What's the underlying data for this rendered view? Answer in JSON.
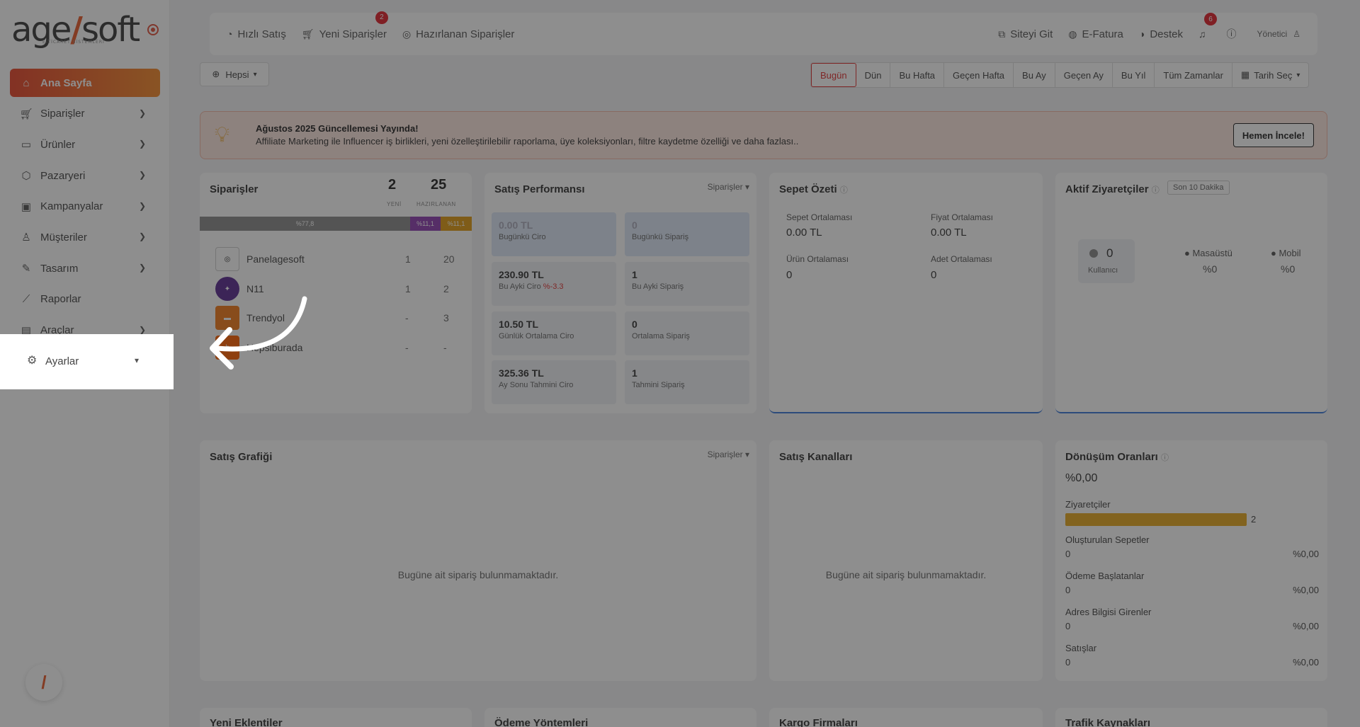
{
  "logo": {
    "brand_a": "age",
    "brand_b": "soft",
    "tagline": "E-TİCARET SİSTEMLERİ"
  },
  "sidebar": {
    "items": [
      {
        "label": "Ana Sayfa",
        "icon": "home-icon",
        "active": true
      },
      {
        "label": "Siparişler",
        "icon": "cart-icon"
      },
      {
        "label": "Ürünler",
        "icon": "book-icon"
      },
      {
        "label": "Pazaryeri",
        "icon": "box-icon"
      },
      {
        "label": "Kampanyalar",
        "icon": "gift-icon"
      },
      {
        "label": "Müşteriler",
        "icon": "user-icon"
      },
      {
        "label": "Tasarım",
        "icon": "edit-icon"
      },
      {
        "label": "Raporlar",
        "icon": "chart-icon"
      },
      {
        "label": "Araçlar",
        "icon": "tools-icon"
      }
    ],
    "highlighted": {
      "label": "Ayarlar",
      "icon": "gear-icon"
    }
  },
  "topbar": {
    "quick_sale": "Hızlı Satış",
    "new_orders": "Yeni Siparişler",
    "new_orders_badge": "2",
    "preparing": "Hazırlanan Siparişler",
    "go_site": "Siteyi Git",
    "einvoice": "E-Fatura",
    "support": "Destek",
    "notif_badge": "6",
    "user": "Yönetici"
  },
  "filters": {
    "store": "Hepsi",
    "ranges": [
      "Bugün",
      "Dün",
      "Bu Hafta",
      "Geçen Hafta",
      "Bu Ay",
      "Geçen Ay",
      "Bu Yıl",
      "Tüm Zamanlar"
    ],
    "date_pick": "Tarih Seç"
  },
  "announcement": {
    "title": "Ağustos 2025 Güncellemesi Yayında!",
    "text": "Affiliate Marketing ile Influencer iş birlikleri, yeni özelleştirilebilir raporlama, üye koleksiyonları, filtre kaydetme özelliği ve daha fazlası..",
    "button": "Hemen İncele!"
  },
  "orders": {
    "title": "Siparişler",
    "new_count": "2",
    "new_label": "YENİ",
    "prep_count": "25",
    "prep_label": "HAZIRLANAN",
    "bar": [
      {
        "label": "%77,8",
        "color": "#8a8a8a",
        "pct": 77.8
      },
      {
        "label": "%11,1",
        "color": "#8e3fb0",
        "pct": 11.1
      },
      {
        "label": "%11,1",
        "color": "#e09a12",
        "pct": 11.1
      }
    ],
    "channels": [
      {
        "name": "Panelagesoft",
        "a": "1",
        "b": "20"
      },
      {
        "name": "N11",
        "a": "1",
        "b": "2"
      },
      {
        "name": "Trendyol",
        "a": "-",
        "b": "3"
      },
      {
        "name": "Hepsiburada",
        "a": "-",
        "b": "-"
      }
    ]
  },
  "performance": {
    "title": "Satış Performansı",
    "filter": "Siparişler",
    "boxes": [
      {
        "value": "0.00 TL",
        "label": "Bugünkü Ciro"
      },
      {
        "value": "0",
        "label": "Bugünkü Sipariş"
      },
      {
        "value": "230.90 TL",
        "label": "Bu Ayki Ciro",
        "delta": "%-3.3"
      },
      {
        "value": "1",
        "label": "Bu Ayki Sipariş"
      },
      {
        "value": "10.50 TL",
        "label": "Günlük Ortalama Ciro"
      },
      {
        "value": "0",
        "label": "Ortalama Sipariş"
      },
      {
        "value": "325.36 TL",
        "label": "Ay Sonu Tahmini Ciro"
      },
      {
        "value": "1",
        "label": "Tahmini Sipariş"
      }
    ]
  },
  "basket": {
    "title": "Sepet Özeti",
    "items": [
      {
        "label": "Sepet Ortalaması",
        "value": "0.00 TL"
      },
      {
        "label": "Fiyat Ortalaması",
        "value": "0.00 TL"
      },
      {
        "label": "Ürün Ortalaması",
        "value": "0"
      },
      {
        "label": "Adet Ortalaması",
        "value": "0"
      }
    ]
  },
  "visitors": {
    "title": "Aktif Ziyaretçiler",
    "badge": "Son 10 Dakika",
    "count": "0",
    "count_label": "Kullanıcı",
    "desktop": "Masaüstü",
    "desktop_pct": "%0",
    "mobile": "Mobil",
    "mobile_pct": "%0"
  },
  "sales_chart": {
    "title": "Satış Grafiği",
    "filter": "Siparişler",
    "empty": "Bugüne ait sipariş bulunmamaktadır."
  },
  "channels": {
    "title": "Satış Kanalları",
    "empty": "Bugüne ait sipariş bulunmamaktadır."
  },
  "conversion": {
    "title": "Dönüşüm Oranları",
    "rate": "%0,00",
    "visitors_label": "Ziyaretçiler",
    "visitors_value": "2",
    "rows": [
      {
        "label": "Oluşturulan Sepetler",
        "value": "0",
        "pct": "%0,00"
      },
      {
        "label": "Ödeme Başlatanlar",
        "value": "0",
        "pct": "%0,00"
      },
      {
        "label": "Adres Bilgisi Girenler",
        "value": "0",
        "pct": "%0,00"
      },
      {
        "label": "Satışlar",
        "value": "0",
        "pct": "%0,00"
      }
    ]
  },
  "row3": [
    "Yeni Eklentiler",
    "Ödeme Yöntemleri",
    "Kargo Firmaları",
    "Trafik Kaynakları"
  ]
}
